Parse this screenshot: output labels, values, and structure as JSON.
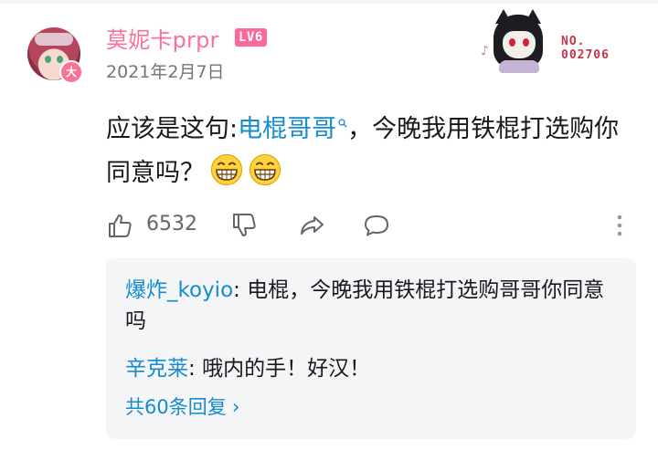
{
  "comment": {
    "username": "莫妮卡prpr",
    "level": "LV6",
    "avatar_badge": "大",
    "date": "2021年2月7日",
    "decoration_number_line1": "NO.",
    "decoration_number_line2": "002706",
    "content_before": "应该是这句:",
    "content_link": "电棍哥哥",
    "content_after": "，今晚我用铁棍打选购你同意吗？",
    "emojis": [
      "grinning-face-emoji",
      "grinning-face-emoji"
    ],
    "like_count": "6532"
  },
  "replies": {
    "items": [
      {
        "user": "爆炸_koyio",
        "separator": ": ",
        "text": "电棍，今晚我用铁棍打选购哥哥你同意吗"
      },
      {
        "user": "辛克莱",
        "separator": ": ",
        "text": "哦内的手！好汉！"
      }
    ],
    "view_more": "共60条回复"
  },
  "colors": {
    "username": "#fb7299",
    "link": "#178bcf",
    "level_badge": "#ff6699",
    "reply_bg": "#f4f5f7"
  },
  "icons": {
    "like": "thumbs-up-icon",
    "dislike": "thumbs-down-icon",
    "share": "share-icon",
    "comment": "comment-icon",
    "more": "more-vertical-icon"
  }
}
